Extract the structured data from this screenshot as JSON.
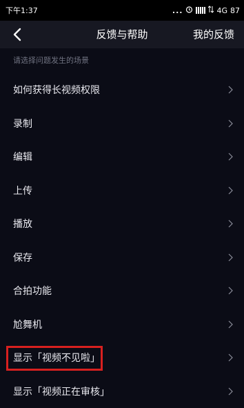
{
  "status_bar": {
    "time": "下午1:37",
    "dots": "...",
    "network": "4G",
    "battery": "87"
  },
  "header": {
    "title": "反馈与帮助",
    "right_action": "我的反馈",
    "back_icon": "chevron-left-icon"
  },
  "hint": "请选择问题发生的场景",
  "items": [
    {
      "label": "如何获得长视频权限"
    },
    {
      "label": "录制"
    },
    {
      "label": "编辑"
    },
    {
      "label": "上传"
    },
    {
      "label": "播放"
    },
    {
      "label": "保存"
    },
    {
      "label": "合拍功能"
    },
    {
      "label": "尬舞机"
    },
    {
      "label": "显示「视频不见啦」"
    },
    {
      "label": "显示「视频正在审核」"
    }
  ],
  "colors": {
    "background": "#0b0c16",
    "header": "#171822",
    "highlight_border": "#d8201f",
    "hint_text": "#6f7280"
  }
}
